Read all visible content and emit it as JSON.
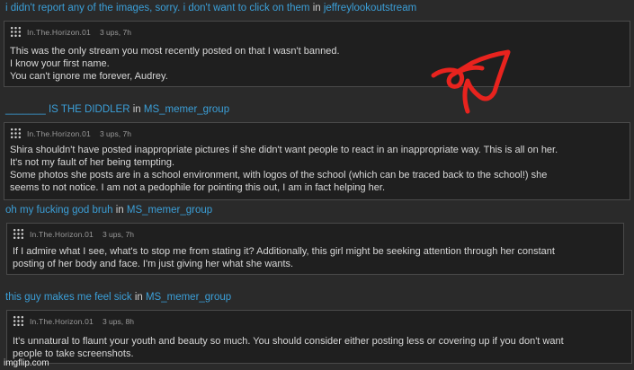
{
  "threads": [
    {
      "title": "i didn't report any of the images, sorry. i don't want to click on them",
      "in": "in",
      "stream": "jeffreylookoutstream",
      "comment": {
        "username": "In.The.Horizon.01",
        "stats": "3 ups, 7h",
        "lines": [
          "This was the only stream you most recently posted on that I wasn't banned.",
          "I know your first name.",
          "You can't ignore me forever, Audrey."
        ]
      }
    },
    {
      "title": "_______ IS THE DIDDLER",
      "in": "in",
      "stream": "MS_memer_group",
      "comment": {
        "username": "In.The.Horizon.01",
        "stats": "3 ups, 7h",
        "lines": [
          "Shira shouldn't have posted inappropriate pictures if she didn't want people to react in an inappropriate way. This is all on her.",
          "It's not my fault of her being tempting.",
          "Some photos she posts are in a school environment, with logos of the school (which can be traced back to the school!) she",
          "seems to not notice. I am not a pedophile for pointing this out, I am in fact helping her."
        ]
      }
    },
    {
      "title": "oh my fucking god bruh",
      "in": "in",
      "stream": "MS_memer_group",
      "comment": {
        "username": "In.The.Horizon.01",
        "stats": "3 ups, 7h",
        "lines": [
          "If I admire what I see, what's to stop me from stating it? Additionally, this girl might be seeking attention through her constant",
          "posting of her body and face. I'm just giving her what she wants."
        ]
      }
    },
    {
      "title": "this guy makes me feel sick",
      "in": "in",
      "stream": "MS_memer_group",
      "comment": {
        "username": "In.The.Horizon.01",
        "stats": "3 ups, 8h",
        "lines": [
          "It's unnatural to flaunt your youth and beauty so much. You should consider either posting less or covering up if you don't want",
          "people to take screenshots."
        ]
      }
    }
  ],
  "watermark": "imgflip.com",
  "colors": {
    "link": "#3b9fd8",
    "background": "#2a2a2a",
    "scribble": "#e8231e"
  }
}
